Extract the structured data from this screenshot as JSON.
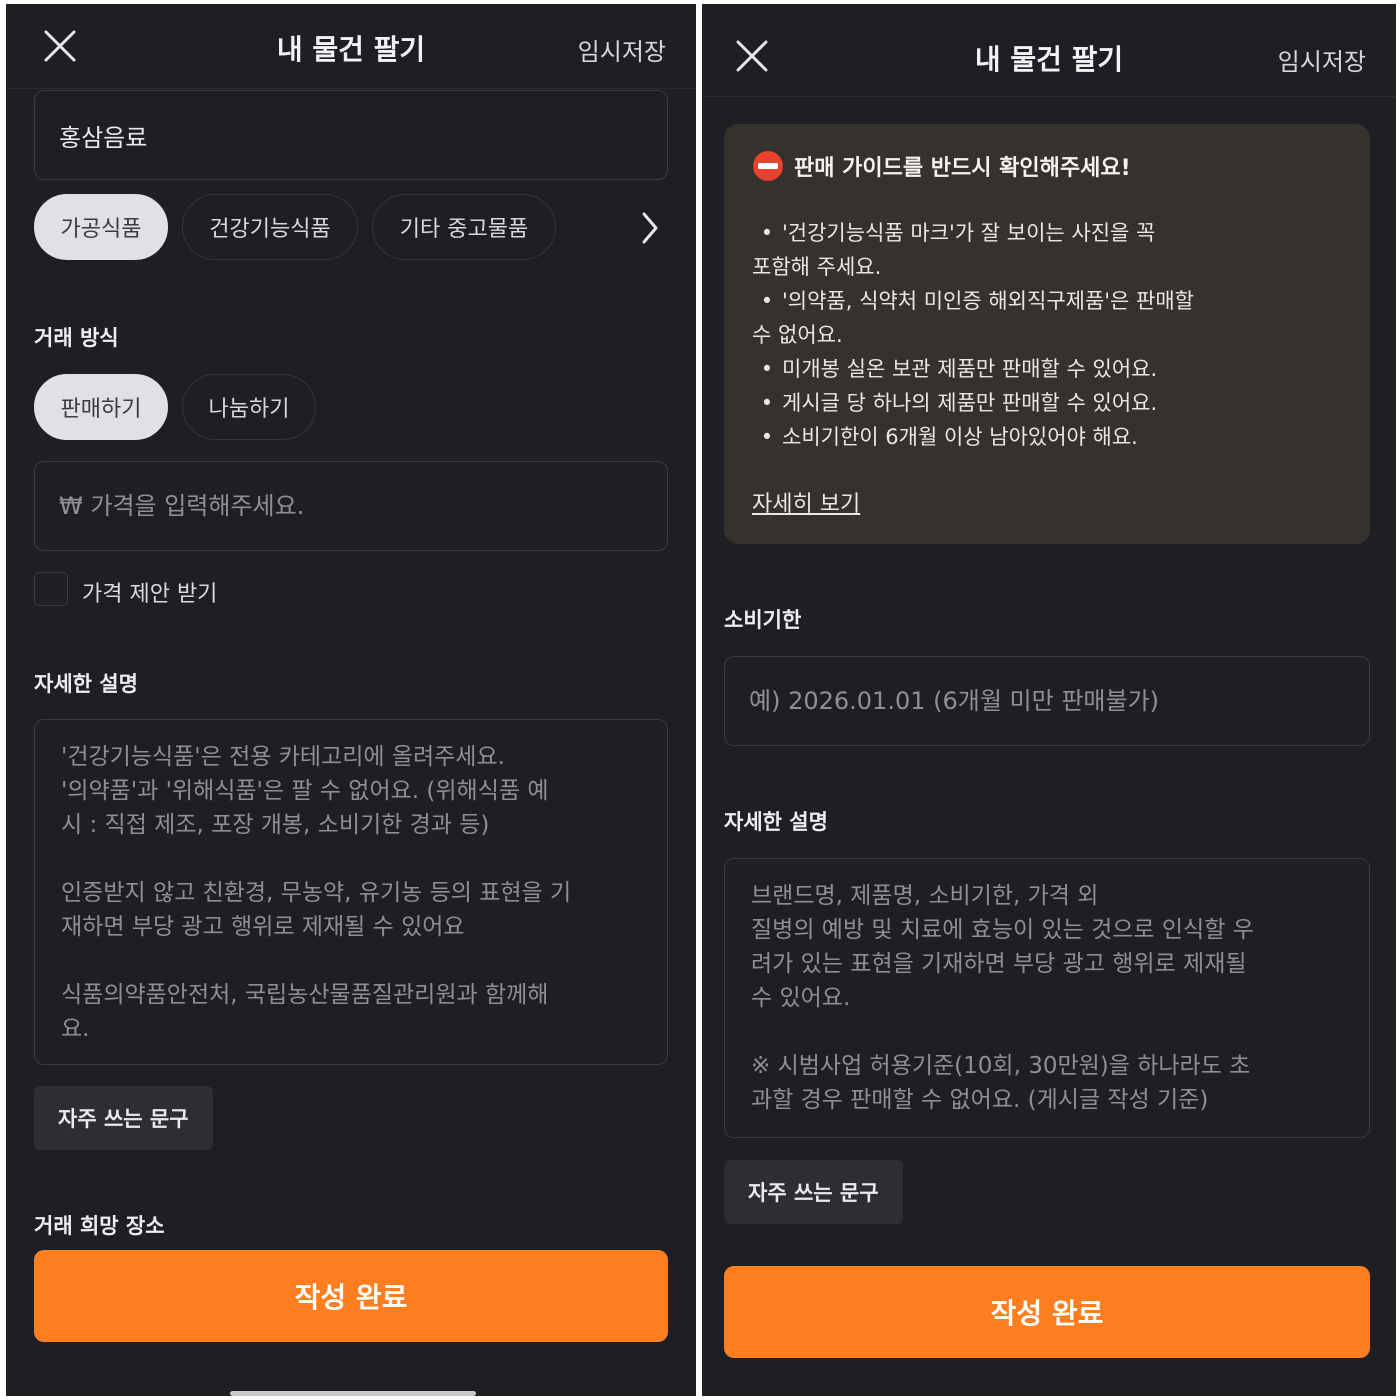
{
  "colors": {
    "background": "#1e1f23",
    "accent_orange": "#ff7e1f",
    "chip_selected": "#dfe1e7",
    "guide_panel": "#35312d",
    "stop_icon_red": "#e8412f"
  },
  "left": {
    "header": {
      "close_icon": "close-icon",
      "title": "내 물건 팔기",
      "temp_save": "임시저장"
    },
    "product_title_value": "홍삼음료",
    "categories": [
      "가공식품",
      "건강기능식품",
      "기타 중고물품"
    ],
    "categories_more_icon": "chevron-right-icon",
    "trade_method": {
      "label": "거래 방식",
      "options": [
        "판매하기",
        "나눔하기"
      ]
    },
    "price": {
      "placeholder": "₩ 가격을 입력해주세요."
    },
    "price_offer_label": "가격 제안 받기",
    "description": {
      "label": "자세한 설명",
      "lines": [
        "'건강기능식품'은 전용 카테고리에 올려주세요.",
        "'의약품'과 '위해식품'은 팔 수 없어요. (위해식품 예",
        "시 : 직접 제조, 포장 개봉, 소비기한 경과 등)",
        "",
        "인증받지 않고 친환경, 무농약, 유기농 등의 표현을 기",
        "재하면 부당 광고 행위로 제재될 수 있어요",
        "",
        "식품의약품안전처, 국립농산물품질관리원과 함께해",
        "요."
      ]
    },
    "frequent_phrase": "자주 쓰는 문구",
    "trade_location_label": "거래 희망 장소",
    "submit": "작성 완료"
  },
  "right": {
    "header": {
      "close_icon": "close-icon",
      "title": "내 물건 팔기",
      "temp_save": "임시저장"
    },
    "guide": {
      "icon": "stop-icon",
      "title": "판매 가이드를 반드시 확인해주세요!",
      "items": [
        "'건강기능식품 마크'가 잘 보이는 사진을 꼭",
        "포함해 주세요.",
        "'의약품, 식약처 미인증 해외직구제품'은 판매할",
        "수 없어요.",
        "미개봉 실온 보관 제품만 판매할 수 있어요.",
        "게시글 당 하나의 제품만 판매할 수 있어요.",
        "소비기한이 6개월 이상 남아있어야 해요."
      ],
      "link": "자세히 보기"
    },
    "expiry": {
      "label": "소비기한",
      "placeholder": "예) 2026.01.01 (6개월 미만 판매불가)"
    },
    "description": {
      "label": "자세한 설명",
      "lines": [
        "브랜드명, 제품명, 소비기한, 가격 외",
        "질병의 예방 및 치료에 효능이 있는 것으로 인식할 우",
        "려가 있는 표현을 기재하면 부당 광고 행위로 제재될",
        "수 있어요.",
        "",
        "※ 시범사업 허용기준(10회, 30만원)을 하나라도 초",
        "과할 경우 판매할 수 없어요. (게시글 작성 기준)"
      ]
    },
    "frequent_phrase": "자주 쓰는 문구",
    "submit": "작성 완료"
  }
}
